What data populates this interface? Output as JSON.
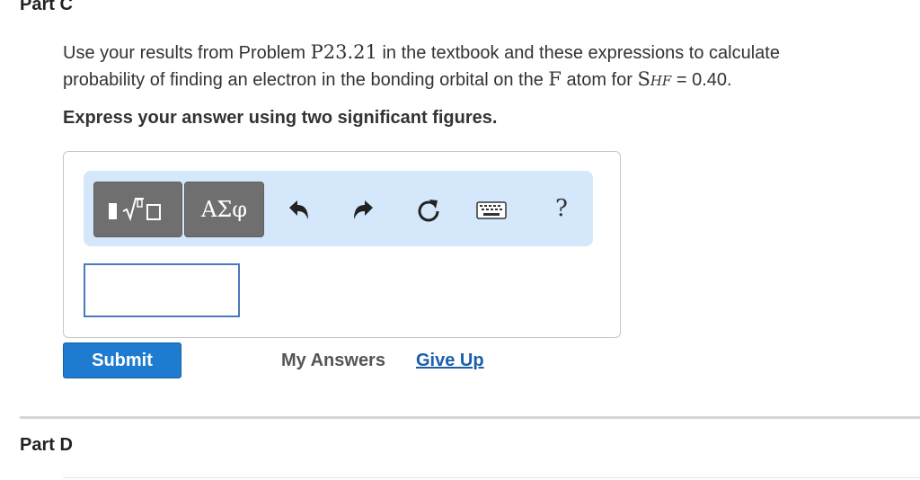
{
  "part_c": {
    "title": "Part C",
    "question_line1_pre": "Use your results from Problem ",
    "problem_ref": "P23.21",
    "question_line1_post": " in the textbook and these expressions to calculate",
    "question_line2_pre": "probability of finding an electron in the bonding orbital on the ",
    "atom": "F",
    "question_line2_mid": " atom for ",
    "s_symbol": "S",
    "s_subscript": "HF",
    "question_line2_post": " = 0.40.",
    "instruction": "Express your answer using two significant figures."
  },
  "toolbar": {
    "templates_icon": "templates-radical-icon",
    "symbols_label": "ΑΣφ",
    "undo_icon": "undo-icon",
    "redo_icon": "redo-icon",
    "reset_icon": "reset-icon",
    "keyboard_icon": "keyboard-icon",
    "help_label": "?",
    "accent_color": "#d4e7fb"
  },
  "answer": {
    "value": ""
  },
  "actions": {
    "submit_label": "Submit",
    "my_answers_label": "My Answers",
    "give_up_label": "Give Up",
    "submit_color": "#1f7bcf",
    "link_color": "#1b5fa8"
  },
  "part_d": {
    "title": "Part D"
  }
}
